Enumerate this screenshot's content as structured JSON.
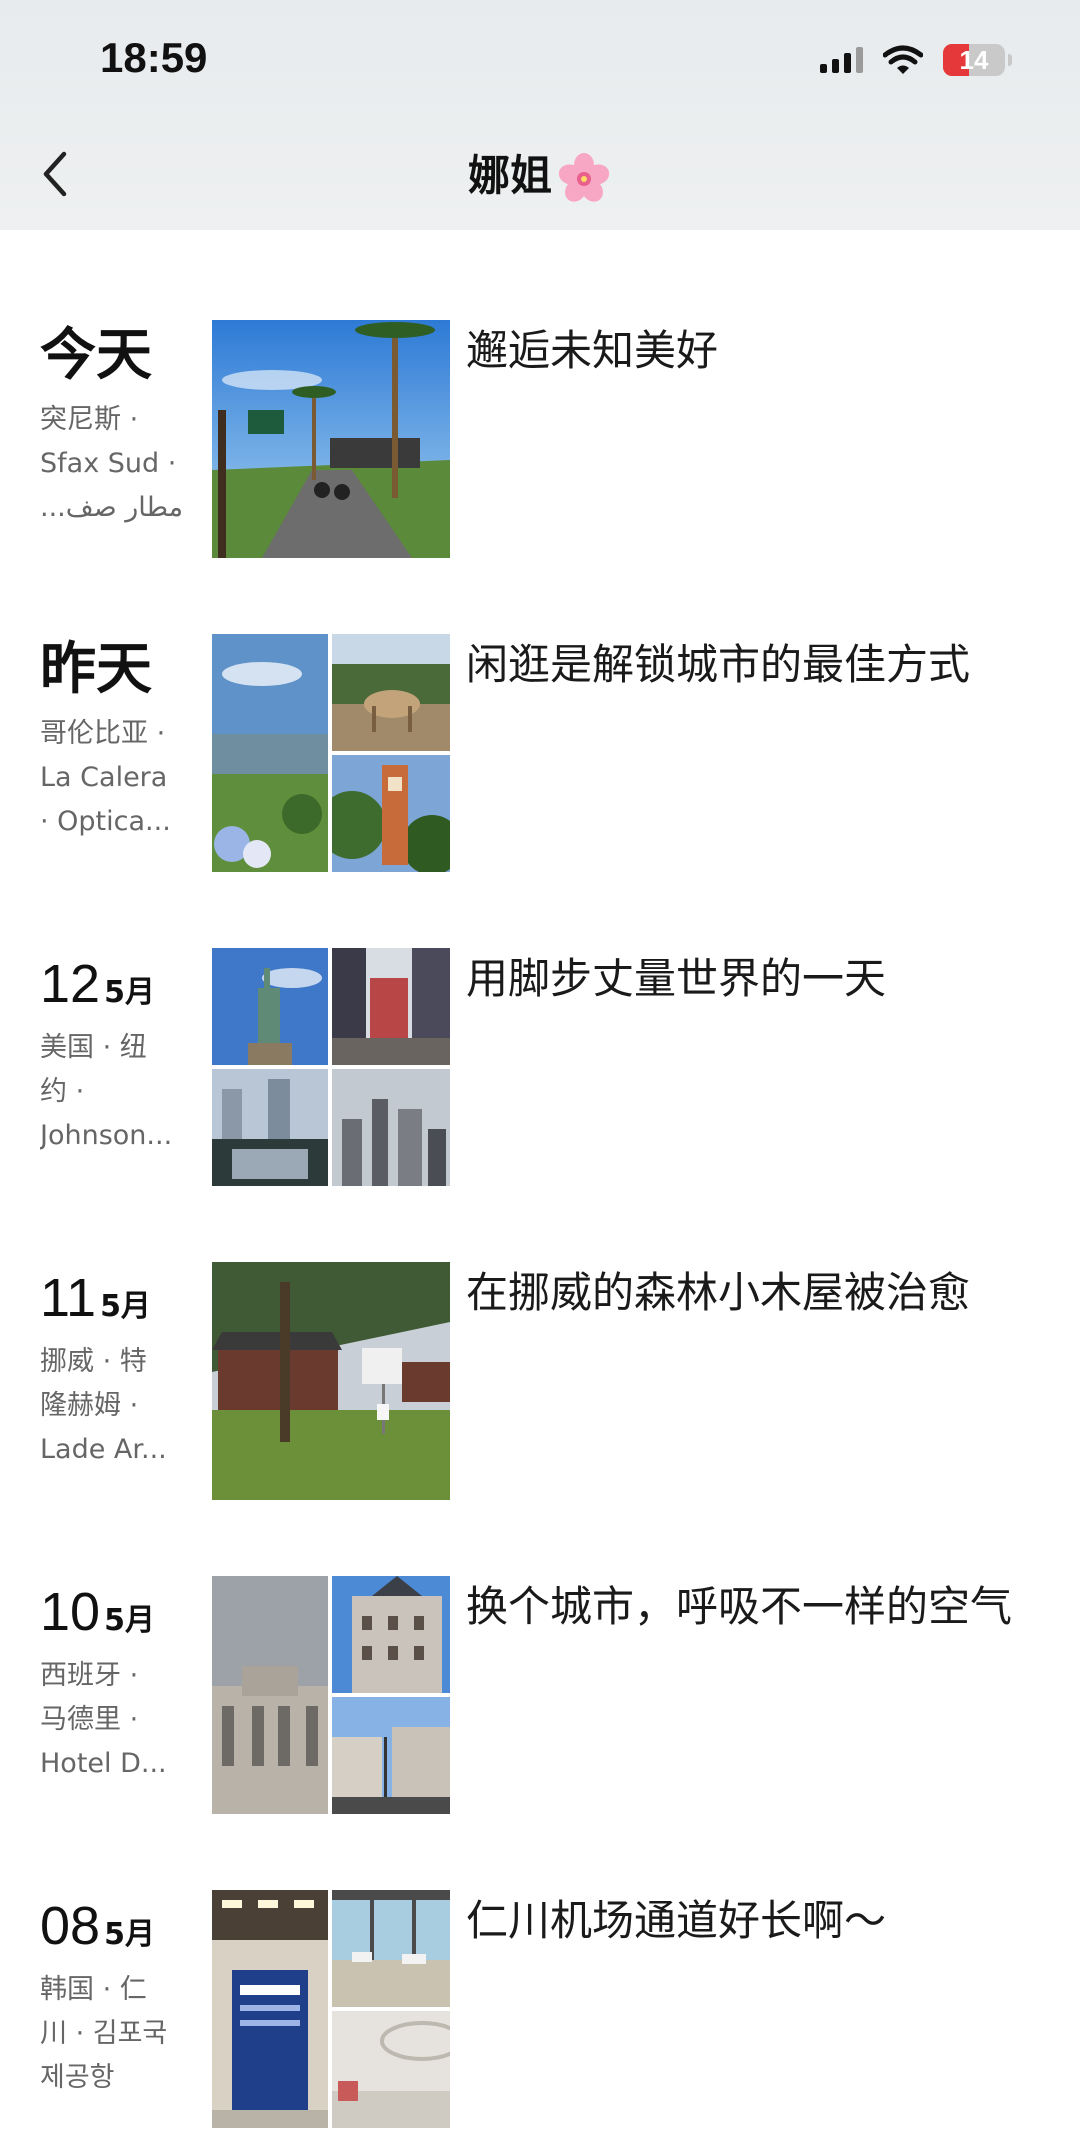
{
  "status_bar": {
    "time": "18:59",
    "battery": "14",
    "battery_level": 0.14
  },
  "nav": {
    "title": "娜姐",
    "title_emoji": "cherry-blossom-icon",
    "back_icon": "chevron-left-icon"
  },
  "entries": [
    {
      "date_word": "今天",
      "location_lines": [
        "突尼斯 ·",
        "Sfax Sud ·",
        "مطار صف..."
      ],
      "caption": "邂逅未知美好",
      "photo_count": 1
    },
    {
      "date_word": "昨天",
      "location_lines": [
        "哥伦比亚 ·",
        "La Calera",
        "· Optica..."
      ],
      "caption": "闲逛是解锁城市的最佳方式",
      "photo_count": 3
    },
    {
      "day": "12",
      "month": "5月",
      "location_lines": [
        "美国 · 纽",
        "约 ·",
        "Johnson..."
      ],
      "caption": "用脚步丈量世界的一天",
      "photo_count": 4
    },
    {
      "day": "11",
      "month": "5月",
      "location_lines": [
        "挪威 · 特",
        "隆赫姆 ·",
        "Lade Ar..."
      ],
      "caption": "在挪威的森林小木屋被治愈",
      "photo_count": 1
    },
    {
      "day": "10",
      "month": "5月",
      "location_lines": [
        "西班牙 ·",
        "马德里 ·",
        "Hotel D..."
      ],
      "caption": "换个城市，呼吸不一样的空气",
      "photo_count": 3
    },
    {
      "day": "08",
      "month": "5月",
      "location_lines": [
        "韩国 · 仁",
        "川 · 김포국",
        "제공항"
      ],
      "caption": "仁川机场通道好长啊～",
      "photo_count": 3
    }
  ]
}
